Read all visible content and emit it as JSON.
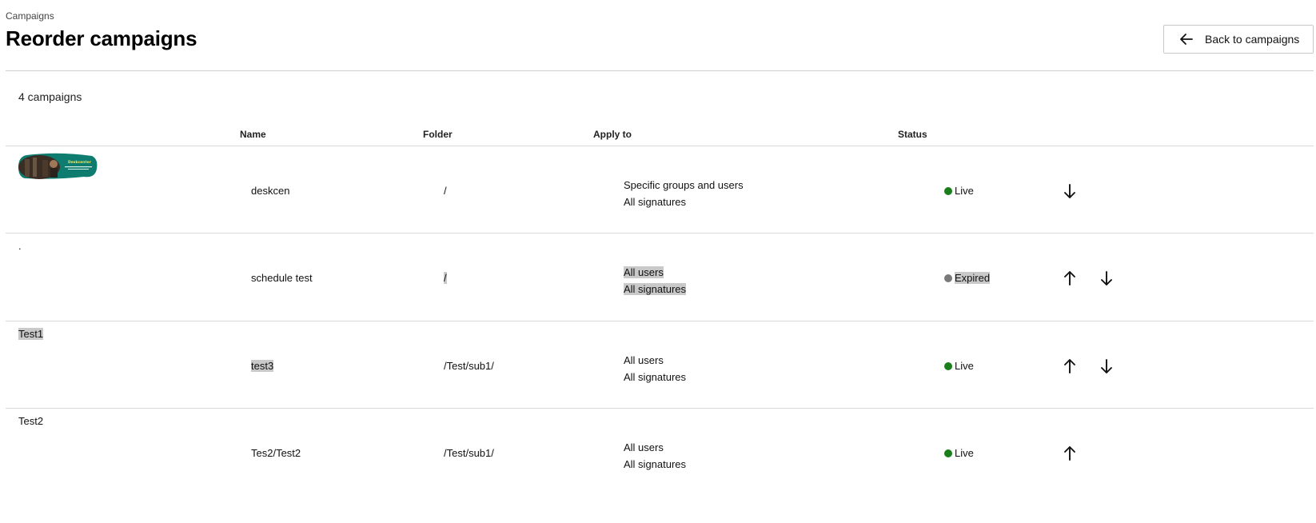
{
  "header": {
    "breadcrumb": "Campaigns",
    "title": "Reorder campaigns",
    "back_button_label": "Back to campaigns",
    "back_icon": "arrow-left-icon"
  },
  "table": {
    "count_label": "4 campaigns",
    "columns": {
      "name": "Name",
      "folder": "Folder",
      "apply_to": "Apply to",
      "status": "Status"
    },
    "rows": [
      {
        "group_label": "",
        "has_image": true,
        "image_text": "Deskcenter",
        "name": "deskcen",
        "folder": "/",
        "apply_line1": "Specific groups and users",
        "apply_line2": "All signatures",
        "status": "Live",
        "status_color": "#1a7f1a",
        "move_up": false,
        "move_down": true
      },
      {
        "group_label": ".",
        "has_image": false,
        "name": "schedule test",
        "folder": "/",
        "apply_line1": "All users",
        "apply_line2": "All signatures",
        "status": "Expired",
        "status_color": "#7a7a7a",
        "move_up": true,
        "move_down": true
      },
      {
        "group_label": "Test1",
        "has_image": false,
        "name": "test3",
        "folder": "/Test/sub1/",
        "apply_line1": "All users",
        "apply_line2": "All signatures",
        "status": "Live",
        "status_color": "#1a7f1a",
        "move_up": true,
        "move_down": true
      },
      {
        "group_label": "Test2",
        "has_image": false,
        "name": "Tes2/Test2",
        "folder": "/Test/sub1/",
        "apply_line1": "All users",
        "apply_line2": "All signatures",
        "status": "Live",
        "status_color": "#1a7f1a",
        "move_up": true,
        "move_down": false
      }
    ]
  },
  "icons": {
    "up": "arrow-up-icon",
    "down": "arrow-down-icon"
  }
}
